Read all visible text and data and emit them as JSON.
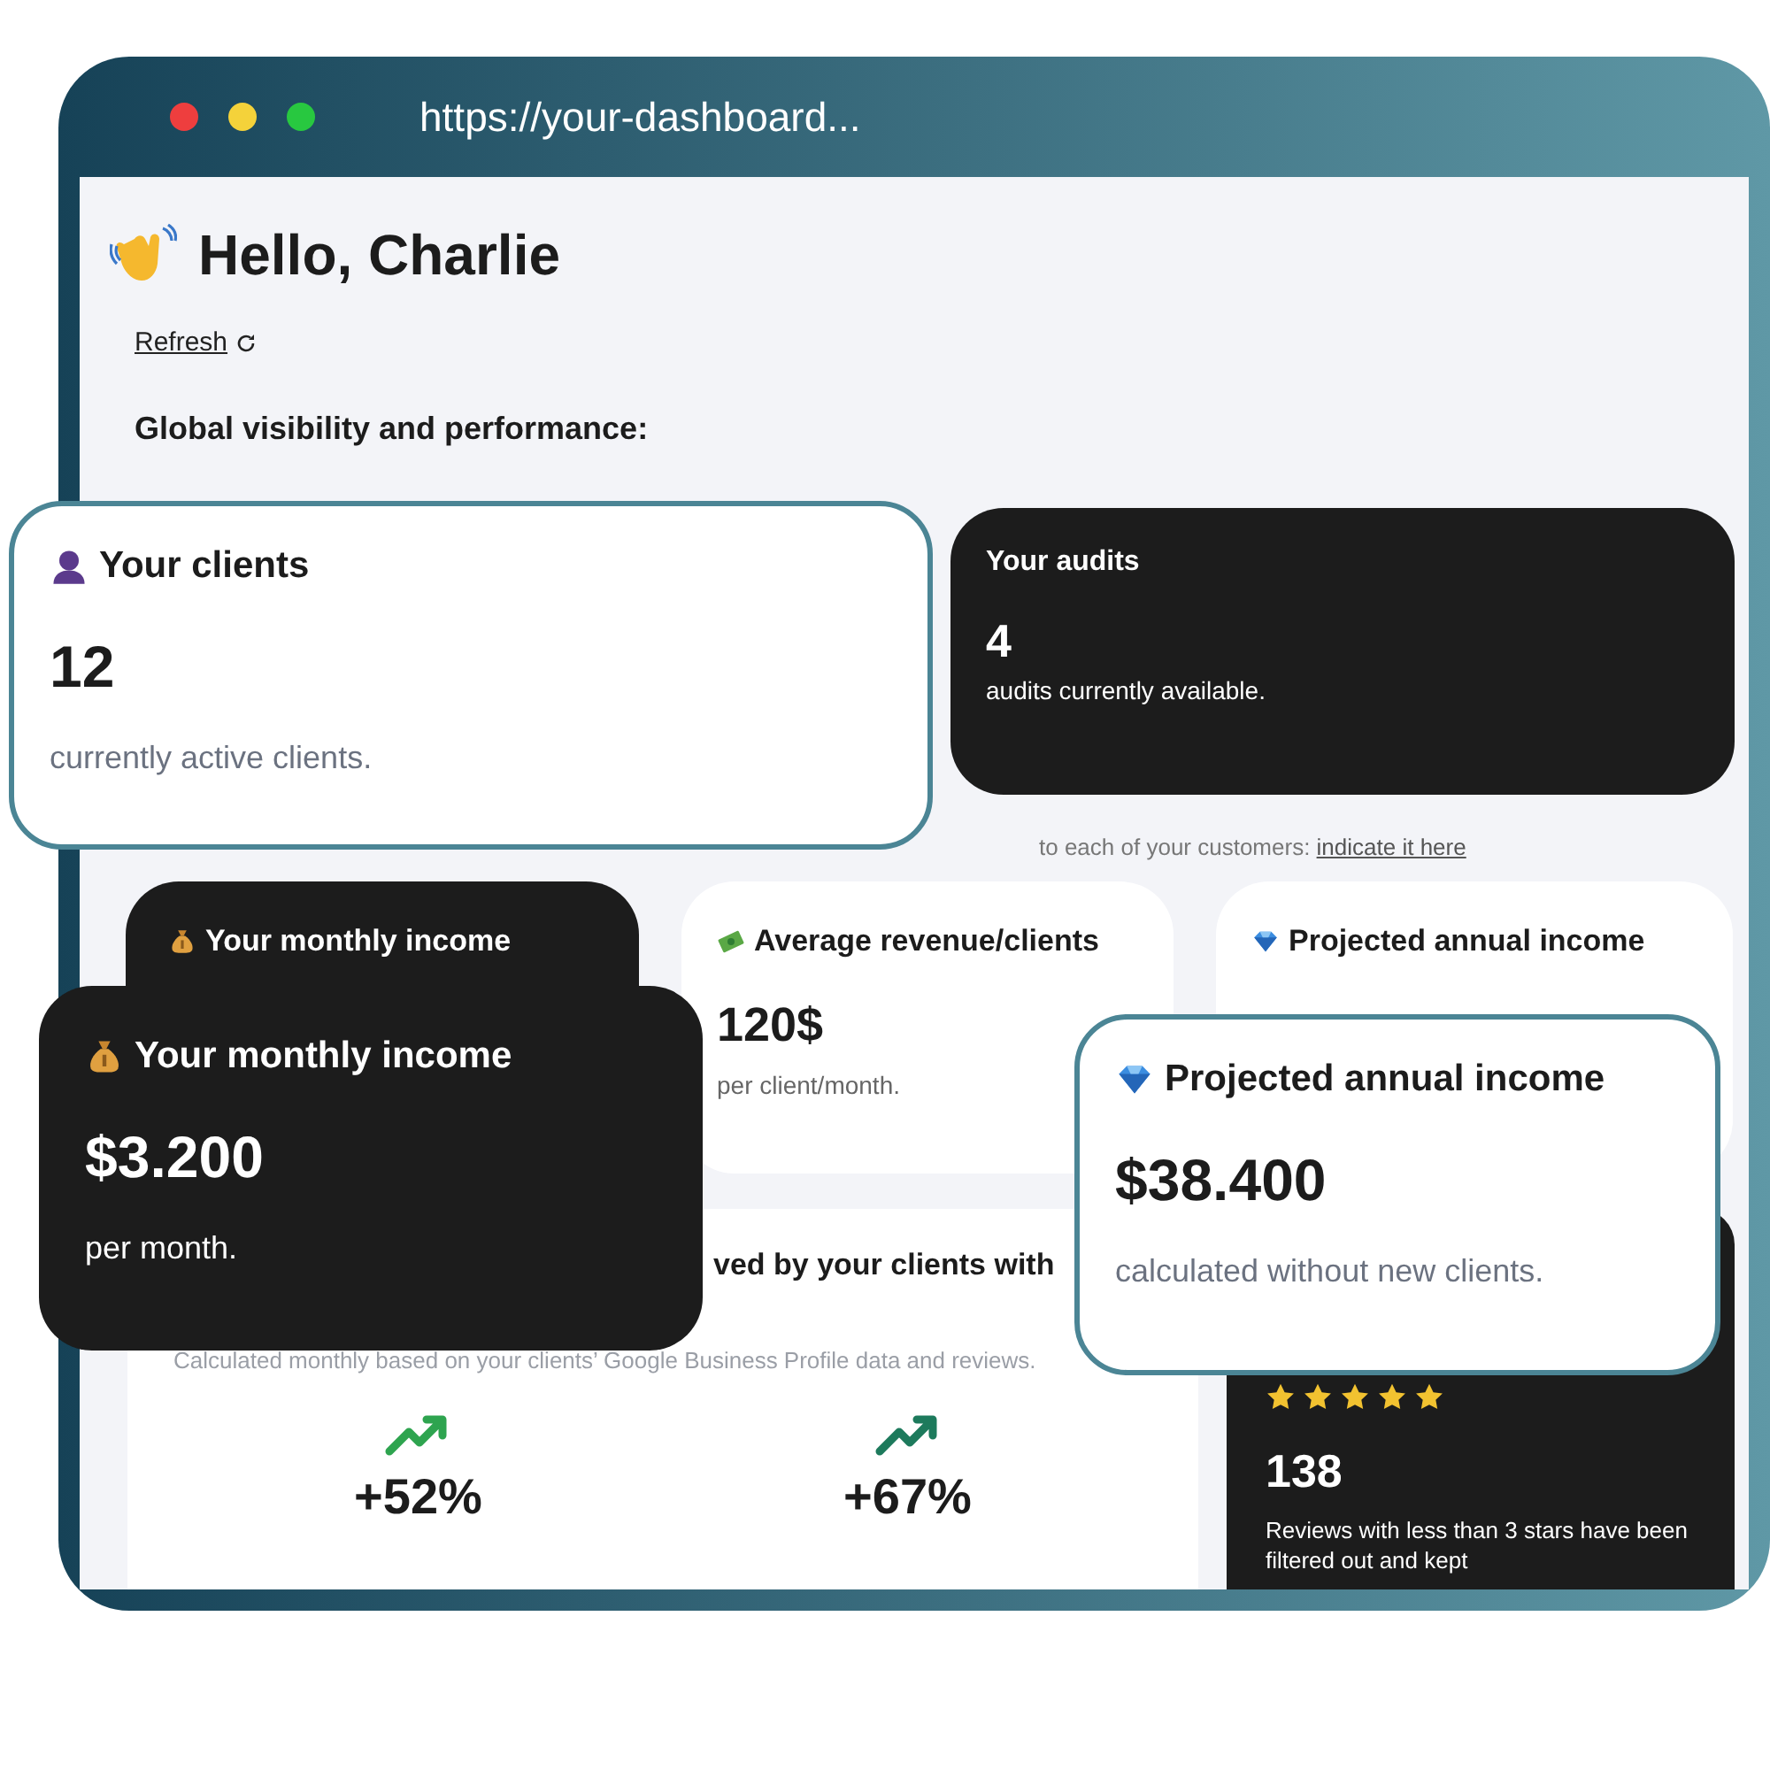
{
  "browser": {
    "url": "https://your-dashboard..."
  },
  "greeting": "Hello, Charlie",
  "refresh": "Refresh",
  "section_title": "Global visibility and performance:",
  "audits_card": {
    "title": "Your audits",
    "value": "4",
    "caption": "audits currently available."
  },
  "note": {
    "text": "to each of your customers:",
    "link": "indicate it here"
  },
  "income_cards": [
    {
      "title": "Your monthly income"
    },
    {
      "title": "Average revenue/clients",
      "value": "120$",
      "caption": "per client/month."
    },
    {
      "title": "Projected annual income"
    }
  ],
  "growth_panel": {
    "title": "ved by your clients with",
    "subtitle": "Calculated monthly based on your clients’ Google Business Profile data and reviews.",
    "metrics": [
      {
        "value": "+52%",
        "color": "#2ea44f"
      },
      {
        "value": "+67%",
        "color": "#1d7a5c"
      }
    ]
  },
  "reviews_card": {
    "stars": 5,
    "count": "138",
    "caption": "Reviews with less than 3 stars have been filtered out and kept"
  },
  "highlights": [
    {
      "title": "Your clients",
      "value": "12",
      "caption": "currently active clients."
    },
    {
      "title": "Your monthly income",
      "value": "$3.200",
      "caption": "per month."
    },
    {
      "title": "Projected annual income",
      "value": "$38.400",
      "caption": "calculated without new clients."
    }
  ]
}
